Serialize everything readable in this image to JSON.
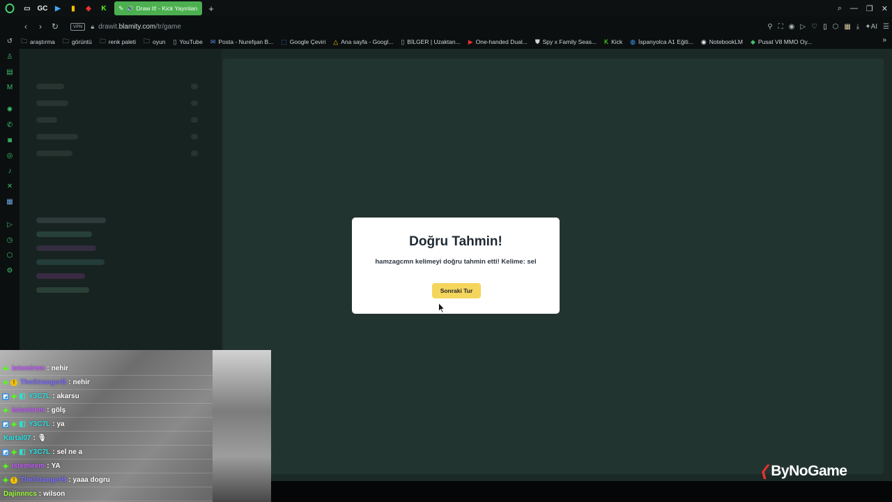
{
  "browser": {
    "pinned_tabs": [
      {
        "name": "messenger-icon",
        "glyph": "▭"
      },
      {
        "name": "gc-icon",
        "glyph": "GC"
      },
      {
        "name": "play-icon",
        "glyph": "▶"
      },
      {
        "name": "bars-icon",
        "glyph": "▮"
      },
      {
        "name": "red-icon",
        "glyph": "◆"
      },
      {
        "name": "kick-icon",
        "glyph": "K"
      }
    ],
    "active_tab_title": "Draw It! - Kick Yayınları",
    "url_prefix": "drawit.",
    "url_domain": "blamity.com",
    "url_path": "/tr/game",
    "vpn_label": "VPN",
    "ai_label": "AI",
    "bookmarks": [
      {
        "icon": "folder",
        "label": "araştırma"
      },
      {
        "icon": "folder",
        "label": "görüntü"
      },
      {
        "icon": "folder",
        "label": "renk paleti"
      },
      {
        "icon": "folder",
        "label": "oyun"
      },
      {
        "icon": "page",
        "label": "YouTube"
      },
      {
        "icon": "mail",
        "label": "Posta - Nurefşan B..."
      },
      {
        "icon": "translate",
        "label": "Google Çeviri"
      },
      {
        "icon": "drive",
        "label": "Ana sayfa - Googl..."
      },
      {
        "icon": "page",
        "label": "BİLGER | Uzaktan..."
      },
      {
        "icon": "video",
        "label": "One-handed Dual..."
      },
      {
        "icon": "shield",
        "label": "Spy x Family Seas..."
      },
      {
        "icon": "kick",
        "label": "Kick"
      },
      {
        "icon": "globe",
        "label": "İspanyolca A1 Eğiti..."
      },
      {
        "icon": "notebook",
        "label": "NotebookLM"
      },
      {
        "icon": "game",
        "label": "Pusat V8 MMO Oy..."
      }
    ]
  },
  "modal": {
    "title": "Doğru Tahmin!",
    "message": "hamzagcmn kelimeyi doğru tahmin etti! Kelime: sel",
    "button_label": "Sonraki Tur"
  },
  "chat": {
    "messages": [
      {
        "badges": [
          "green"
        ],
        "user": "istemirem",
        "color": "#c55bff",
        "text": "nehir"
      },
      {
        "badges": [
          "green",
          "gold"
        ],
        "user": "TheStrangerB",
        "color": "#7a6cff",
        "text": "nehir"
      },
      {
        "badges": [
          "blue",
          "green",
          "sub"
        ],
        "user": "Y3C7L",
        "color": "#2be3e3",
        "text": "akarsu"
      },
      {
        "badges": [
          "green"
        ],
        "user": "istemirem",
        "color": "#c55bff",
        "text": "gölş"
      },
      {
        "badges": [
          "blue",
          "green",
          "sub"
        ],
        "user": "Y3C7L",
        "color": "#2be3e3",
        "text": "ya"
      },
      {
        "badges": [],
        "user": "Kartal07",
        "color": "#2be3e3",
        "text": "🎙"
      },
      {
        "badges": [
          "blue",
          "green",
          "sub"
        ],
        "user": "Y3C7L",
        "color": "#2be3e3",
        "text": "sel ne a"
      },
      {
        "badges": [
          "green"
        ],
        "user": "istemirem",
        "color": "#c55bff",
        "text": "YA"
      },
      {
        "badges": [
          "green",
          "gold"
        ],
        "user": "TheStrangerB",
        "color": "#7a6cff",
        "text": "yaaa dogru"
      },
      {
        "badges": [],
        "user": "Dajinnncs",
        "color": "#9dff3a",
        "text": "wilson"
      }
    ]
  },
  "watermark": "ByNoGame",
  "colors": {
    "kick_green": "#53fc18",
    "modal_button": "#f4d65c",
    "page_bg": "#1b2a27"
  }
}
